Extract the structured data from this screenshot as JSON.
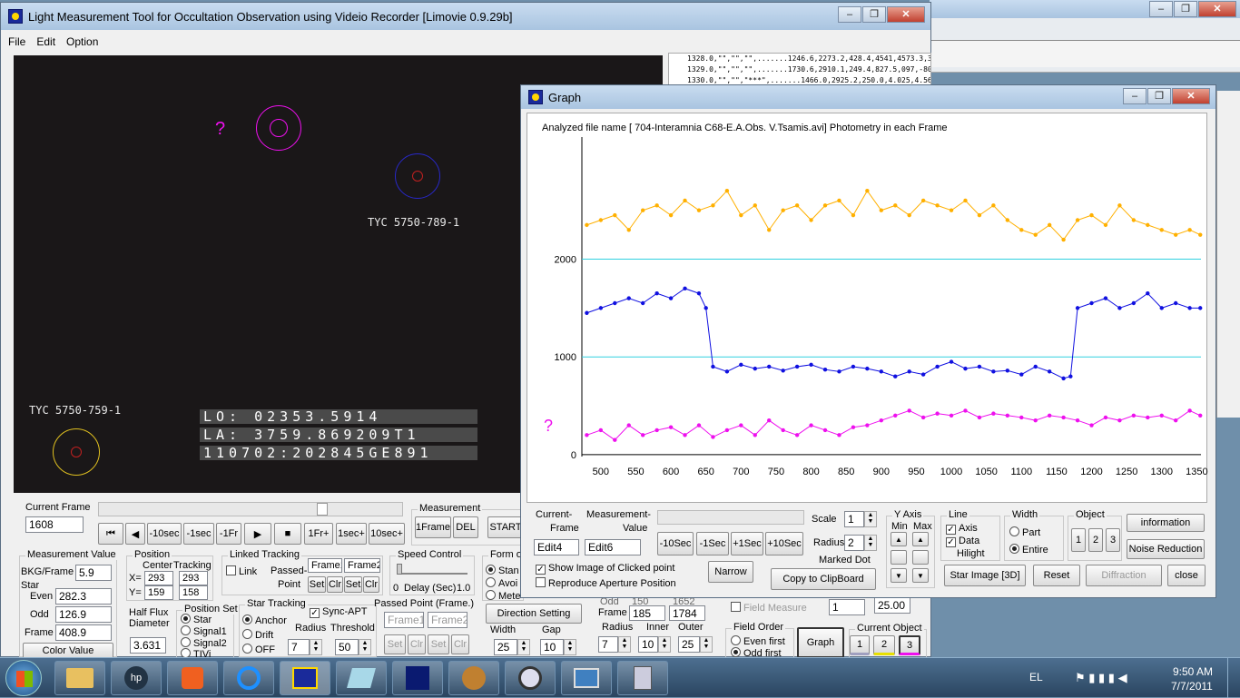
{
  "main_window": {
    "title": "Light Measurement Tool for Occultation Observation using Videio Recorder [Limovie 0.9.29b]",
    "menu": [
      "File",
      "Edit",
      "Option"
    ]
  },
  "video": {
    "question_mark": "?",
    "star_labels": [
      "TYC 5750-789-1",
      "TYC 5750-759-1"
    ],
    "osd_lines": [
      "LO: 02353.5914",
      "LA: 3759.869209T1",
      "110702:202845GE891"
    ]
  },
  "log_lines": [
    "1328.0,\"\",\"\",\"\",.......1246.6,2273.2,428.4,4541,4573.3,3",
    "1329.0,\"\",\"\",\"\",.......1730.6,2910.1,249.4,827.5,097,-80.",
    "1330.0,\"\",\"\",\"***\",.......1466.0,2925.2,250.0,4.025,4.567"
  ],
  "controls": {
    "current_frame_label": "Current Frame",
    "current_frame_value": "1608",
    "nav_buttons": [
      "⏮",
      "◀",
      "-10sec",
      "-1sec",
      "-1Fr",
      "▶",
      "■",
      "1Fr+",
      "1sec+",
      "10sec+"
    ],
    "measurement_label": "Measurement",
    "measurement_buttons": [
      "1Frame",
      "DEL",
      "START"
    ],
    "measurement_value": {
      "caption": "Measurement Value",
      "bkg_label": "BKG/Frame",
      "bkg_value": "5.9",
      "star_label": "Star",
      "even_label": "Even",
      "even_value": "282.3",
      "odd_label": "Odd",
      "odd_value": "126.9",
      "frame_label": "Frame",
      "frame_value": "408.9",
      "color_button": "Color Value"
    },
    "position": {
      "caption": "Position",
      "center_label": "Center",
      "tracking_label": "Tracking",
      "x_label": "X=",
      "y_label": "Y=",
      "x_center": "293",
      "y_center": "159",
      "x_tracking": "293",
      "y_tracking": "158"
    },
    "linked_tracking": {
      "caption": "Linked Tracking",
      "link_label": "Link",
      "passed_point_label": "Passed-",
      "point_label": "Point",
      "frame1": "Frame1",
      "frame2": "Frame2",
      "set": "Set",
      "clr": "Clr"
    },
    "speed_control": {
      "caption": "Speed Control",
      "left": "0",
      "mid": "Delay (Sec)",
      "right": "1.0"
    },
    "form_of": {
      "caption": "Form of",
      "options": [
        "Stan",
        "Avoi",
        "Mete"
      ]
    },
    "half_flux": {
      "caption1": "Half Flux",
      "caption2": "Diameter",
      "value": "3.631"
    },
    "position_set": {
      "caption": "Position Set",
      "options": [
        "Star",
        "Signal1",
        "Signal2",
        "TIVi"
      ]
    },
    "star_tracking": {
      "caption": "Star Tracking",
      "options": [
        "Anchor",
        "Drift",
        "OFF"
      ],
      "sync_apt": "Sync-APT",
      "radius_label": "Radius",
      "threshold_label": "Threshold",
      "radius_value": "7",
      "threshold_value": "50"
    },
    "passed_point_frame": {
      "caption": "Passed Point (Frame.)",
      "frame1": "Frame1",
      "frame2": "Frame2",
      "set": "Set",
      "clr": "Clr"
    },
    "direction_setting": "Direction Setting",
    "width_label": "Width",
    "width_value": "25",
    "gap_label": "Gap",
    "gap_value": "10",
    "aperture": {
      "odd": "Odd",
      "odd_val": "150",
      "odd_val2": "1652",
      "frame_label": "Frame",
      "frame_val1": "185",
      "frame_val2": "1784",
      "radius_label": "Radius",
      "inner_label": "Inner",
      "outer_label": "Outer",
      "radius_value": "7",
      "inner_value": "10",
      "outer_value": "25"
    },
    "field_measure": {
      "label": "Field Measure",
      "value": "1",
      "value2": "25.00"
    },
    "field_order": {
      "caption": "Field Order",
      "options": [
        "Even first",
        "Odd first"
      ]
    },
    "graph_button": "Graph",
    "current_object": {
      "caption": "Current Object",
      "options": [
        "1",
        "2",
        "3"
      ]
    }
  },
  "graph_window": {
    "title": "Graph",
    "header": "Analyzed file name [ 704-Interamnia C68-E.A.Obs. V.Tsamis.avi]   Photometry in each Frame",
    "question_mark": "?",
    "current_frame_label1": "Current-",
    "current_frame_label2": "Frame",
    "measurement_label1": "Measurement-",
    "measurement_label2": "Value",
    "edit4": "Edit4",
    "edit6": "Edit6",
    "nav_buttons": [
      "-10Sec",
      "-1Sec",
      "+1Sec",
      "+10Sec"
    ],
    "scale_label": "Scale",
    "scale_value": "1",
    "radius_label": "Radius",
    "radius_value": "2",
    "marked_dot": "Marked Dot",
    "y_axis": {
      "caption": "Y Axis",
      "min": "Min",
      "max": "Max"
    },
    "line": {
      "caption": "Line",
      "axis": "Axis",
      "data": "Data",
      "hilight": "Hilight"
    },
    "width": {
      "caption": "Width",
      "part": "Part",
      "entire": "Entire"
    },
    "object": {
      "caption": "Object",
      "options": [
        "1",
        "2",
        "3"
      ]
    },
    "information": "information",
    "noise_reduction": "Noise Reduction",
    "show_image": "Show Image of Clicked point",
    "reproduce": "Reproduce Aperture Position",
    "narrow": "Narrow",
    "copy": "Copy to ClipBoard",
    "star_image": "Star Image [3D]",
    "reset": "Reset",
    "diffraction": "Diffraction",
    "close": "close"
  },
  "chart_data": {
    "type": "line",
    "title": "",
    "xlabel": "",
    "ylabel": "",
    "xlim": [
      473,
      1356
    ],
    "ylim": [
      -20,
      3250
    ],
    "x_ticks": [
      500,
      550,
      600,
      650,
      700,
      750,
      800,
      850,
      900,
      950,
      1000,
      1050,
      1100,
      1150,
      1200,
      1250,
      1300,
      1350
    ],
    "y_ticks": [
      0,
      1000,
      2000
    ],
    "reference_lines": [
      1000,
      2000
    ],
    "series": [
      {
        "color": "#ffb000",
        "x": [
          480,
          500,
          520,
          540,
          560,
          580,
          600,
          620,
          640,
          660,
          680,
          700,
          720,
          740,
          760,
          780,
          800,
          820,
          840,
          860,
          880,
          900,
          920,
          940,
          960,
          980,
          1000,
          1020,
          1040,
          1060,
          1080,
          1100,
          1120,
          1140,
          1160,
          1180,
          1200,
          1220,
          1240,
          1260,
          1280,
          1300,
          1320,
          1340,
          1355
        ],
        "values": [
          2350,
          2400,
          2450,
          2300,
          2500,
          2550,
          2450,
          2600,
          2500,
          2550,
          2700,
          2450,
          2550,
          2300,
          2500,
          2550,
          2400,
          2550,
          2600,
          2450,
          2700,
          2500,
          2550,
          2450,
          2600,
          2550,
          2500,
          2600,
          2450,
          2550,
          2400,
          2300,
          2250,
          2350,
          2200,
          2400,
          2450,
          2350,
          2550,
          2400,
          2350,
          2300,
          2250,
          2300,
          2250
        ]
      },
      {
        "color": "#1010e0",
        "x": [
          480,
          500,
          520,
          540,
          560,
          580,
          600,
          620,
          640,
          650,
          660,
          680,
          700,
          720,
          740,
          760,
          780,
          800,
          820,
          840,
          860,
          880,
          900,
          920,
          940,
          960,
          980,
          1000,
          1020,
          1040,
          1060,
          1080,
          1100,
          1120,
          1140,
          1160,
          1170,
          1180,
          1200,
          1220,
          1240,
          1260,
          1280,
          1300,
          1320,
          1340,
          1355
        ],
        "values": [
          1450,
          1500,
          1550,
          1600,
          1550,
          1650,
          1600,
          1700,
          1650,
          1500,
          900,
          850,
          920,
          880,
          900,
          860,
          900,
          920,
          870,
          850,
          900,
          880,
          850,
          800,
          850,
          820,
          900,
          950,
          880,
          900,
          850,
          860,
          820,
          900,
          850,
          780,
          800,
          1500,
          1550,
          1600,
          1500,
          1550,
          1650,
          1500,
          1550,
          1500,
          1500
        ]
      },
      {
        "color": "#ee10ee",
        "x": [
          480,
          500,
          520,
          540,
          560,
          580,
          600,
          620,
          640,
          660,
          680,
          700,
          720,
          740,
          760,
          780,
          800,
          820,
          840,
          860,
          880,
          900,
          920,
          940,
          960,
          980,
          1000,
          1020,
          1040,
          1060,
          1080,
          1100,
          1120,
          1140,
          1160,
          1180,
          1200,
          1220,
          1240,
          1260,
          1280,
          1300,
          1320,
          1340,
          1355
        ],
        "values": [
          200,
          250,
          150,
          300,
          200,
          250,
          280,
          200,
          300,
          180,
          250,
          300,
          200,
          350,
          250,
          200,
          300,
          250,
          200,
          280,
          300,
          350,
          400,
          450,
          380,
          420,
          400,
          450,
          380,
          420,
          400,
          380,
          350,
          400,
          380,
          350,
          300,
          380,
          350,
          400,
          380,
          400,
          350,
          450,
          400
        ]
      }
    ]
  },
  "taskbar": {
    "language": "EL",
    "time": "9:50 AM",
    "date": "7/7/2011"
  }
}
